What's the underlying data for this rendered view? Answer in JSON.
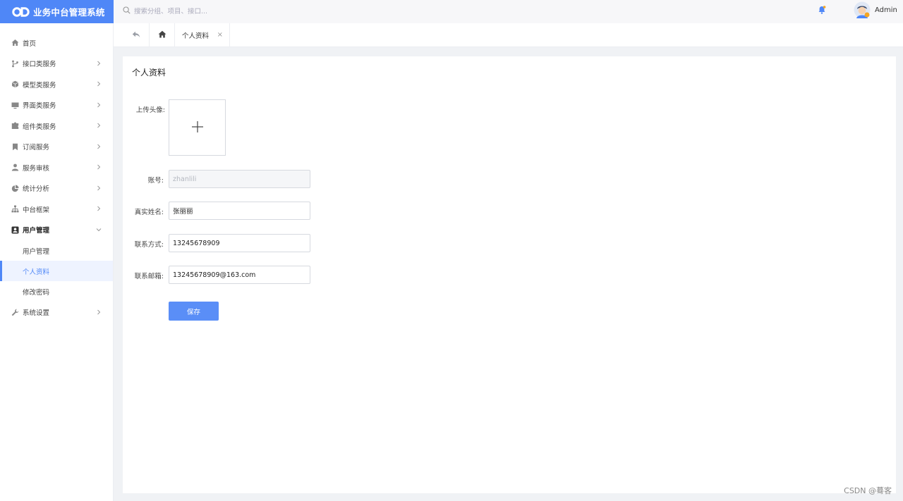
{
  "app": {
    "title": "业务中台管理系统"
  },
  "colors": {
    "brand": "#4f87f7",
    "active_bg": "#eef3ff"
  },
  "search": {
    "placeholder": "搜索分组、项目、接口..."
  },
  "user": {
    "name": "Admin"
  },
  "sidebar": {
    "items": [
      {
        "label": "首页",
        "icon": "home-icon"
      },
      {
        "label": "接口类服务",
        "icon": "branch-icon"
      },
      {
        "label": "模型类服务",
        "icon": "cube-icon"
      },
      {
        "label": "界面类服务",
        "icon": "monitor-icon"
      },
      {
        "label": "组件类服务",
        "icon": "puzzle-icon"
      },
      {
        "label": "订阅服务",
        "icon": "bookmark-icon"
      },
      {
        "label": "服务审核",
        "icon": "person-icon"
      },
      {
        "label": "统计分析",
        "icon": "pie-icon"
      },
      {
        "label": "中台框架",
        "icon": "sitemap-icon"
      },
      {
        "label": "用户管理",
        "icon": "user-card-icon"
      },
      {
        "label": "系统设置",
        "icon": "wrench-icon"
      }
    ],
    "user_mgmt_sub": [
      {
        "label": "用户管理"
      },
      {
        "label": "个人资料"
      },
      {
        "label": "修改密码"
      }
    ]
  },
  "tabs": {
    "current": "个人资料",
    "close": "×"
  },
  "profile": {
    "title": "个人资料",
    "avatar_label": "上传头像:",
    "account_label": "账号:",
    "account_value": "zhanlili",
    "name_label": "真实姓名:",
    "name_value": "张丽丽",
    "phone_label": "联系方式:",
    "phone_value": "13245678909",
    "email_label": "联系邮箱:",
    "email_value": "13245678909@163.com",
    "save_label": "保存"
  },
  "watermark": "CSDN @蓦客"
}
